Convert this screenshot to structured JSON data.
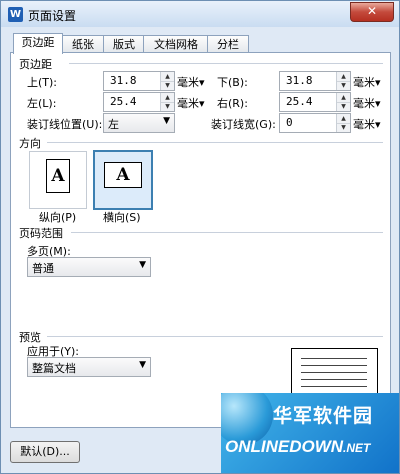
{
  "window": {
    "title": "页面设置",
    "app_icon": "W",
    "close_glyph": "✕"
  },
  "tabs": [
    "页边距",
    "纸张",
    "版式",
    "文档网格",
    "分栏"
  ],
  "margins": {
    "section_label": "页边距",
    "top": {
      "label": "上(T):",
      "value": "31.8",
      "unit": "毫米▾"
    },
    "bottom": {
      "label": "下(B):",
      "value": "31.8",
      "unit": "毫米▾"
    },
    "left": {
      "label": "左(L):",
      "value": "25.4",
      "unit": "毫米▾"
    },
    "right": {
      "label": "右(R):",
      "value": "25.4",
      "unit": "毫米▾"
    },
    "gutter_position": {
      "label": "装订线位置(U):",
      "value": "左"
    },
    "gutter_width": {
      "label": "装订线宽(G):",
      "value": "0",
      "unit": "毫米▾"
    }
  },
  "orientation": {
    "section_label": "方向",
    "portrait": {
      "glyph": "A",
      "label": "纵向(P)"
    },
    "landscape": {
      "glyph": "A",
      "label": "横向(S)",
      "selected": true
    }
  },
  "page_range": {
    "section_label": "页码范围",
    "multiple_pages_label": "多页(M):",
    "multiple_pages_value": "普通"
  },
  "preview": {
    "section_label": "预览",
    "apply_to_label": "应用于(Y):",
    "apply_to_value": "整篇文档"
  },
  "buttons": {
    "default": "默认(D)..."
  },
  "watermark": {
    "cn": "华军软件园",
    "en": "ONLINEDOWN",
    "net": ".NET"
  }
}
